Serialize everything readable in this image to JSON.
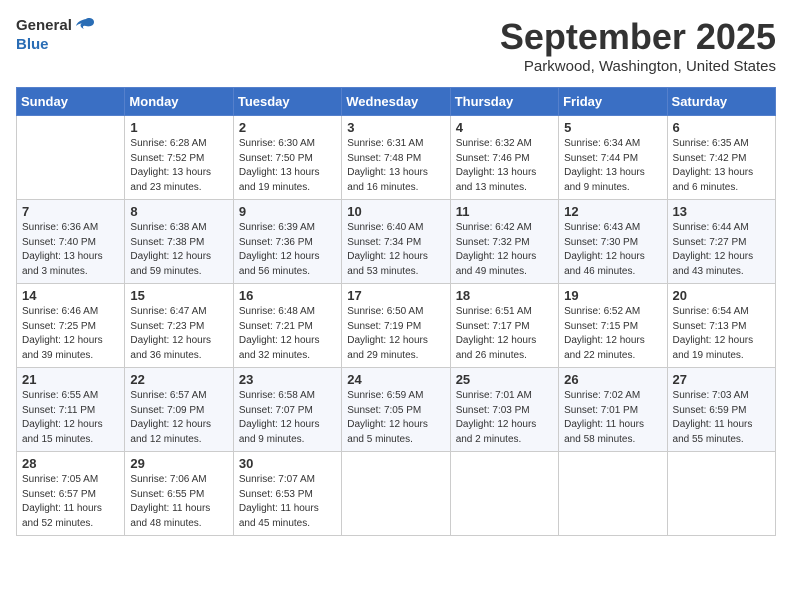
{
  "header": {
    "logo_general": "General",
    "logo_blue": "Blue",
    "month_title": "September 2025",
    "location": "Parkwood, Washington, United States"
  },
  "weekdays": [
    "Sunday",
    "Monday",
    "Tuesday",
    "Wednesday",
    "Thursday",
    "Friday",
    "Saturday"
  ],
  "weeks": [
    [
      {
        "day": "",
        "detail": ""
      },
      {
        "day": "1",
        "detail": "Sunrise: 6:28 AM\nSunset: 7:52 PM\nDaylight: 13 hours\nand 23 minutes."
      },
      {
        "day": "2",
        "detail": "Sunrise: 6:30 AM\nSunset: 7:50 PM\nDaylight: 13 hours\nand 19 minutes."
      },
      {
        "day": "3",
        "detail": "Sunrise: 6:31 AM\nSunset: 7:48 PM\nDaylight: 13 hours\nand 16 minutes."
      },
      {
        "day": "4",
        "detail": "Sunrise: 6:32 AM\nSunset: 7:46 PM\nDaylight: 13 hours\nand 13 minutes."
      },
      {
        "day": "5",
        "detail": "Sunrise: 6:34 AM\nSunset: 7:44 PM\nDaylight: 13 hours\nand 9 minutes."
      },
      {
        "day": "6",
        "detail": "Sunrise: 6:35 AM\nSunset: 7:42 PM\nDaylight: 13 hours\nand 6 minutes."
      }
    ],
    [
      {
        "day": "7",
        "detail": "Sunrise: 6:36 AM\nSunset: 7:40 PM\nDaylight: 13 hours\nand 3 minutes."
      },
      {
        "day": "8",
        "detail": "Sunrise: 6:38 AM\nSunset: 7:38 PM\nDaylight: 12 hours\nand 59 minutes."
      },
      {
        "day": "9",
        "detail": "Sunrise: 6:39 AM\nSunset: 7:36 PM\nDaylight: 12 hours\nand 56 minutes."
      },
      {
        "day": "10",
        "detail": "Sunrise: 6:40 AM\nSunset: 7:34 PM\nDaylight: 12 hours\nand 53 minutes."
      },
      {
        "day": "11",
        "detail": "Sunrise: 6:42 AM\nSunset: 7:32 PM\nDaylight: 12 hours\nand 49 minutes."
      },
      {
        "day": "12",
        "detail": "Sunrise: 6:43 AM\nSunset: 7:30 PM\nDaylight: 12 hours\nand 46 minutes."
      },
      {
        "day": "13",
        "detail": "Sunrise: 6:44 AM\nSunset: 7:27 PM\nDaylight: 12 hours\nand 43 minutes."
      }
    ],
    [
      {
        "day": "14",
        "detail": "Sunrise: 6:46 AM\nSunset: 7:25 PM\nDaylight: 12 hours\nand 39 minutes."
      },
      {
        "day": "15",
        "detail": "Sunrise: 6:47 AM\nSunset: 7:23 PM\nDaylight: 12 hours\nand 36 minutes."
      },
      {
        "day": "16",
        "detail": "Sunrise: 6:48 AM\nSunset: 7:21 PM\nDaylight: 12 hours\nand 32 minutes."
      },
      {
        "day": "17",
        "detail": "Sunrise: 6:50 AM\nSunset: 7:19 PM\nDaylight: 12 hours\nand 29 minutes."
      },
      {
        "day": "18",
        "detail": "Sunrise: 6:51 AM\nSunset: 7:17 PM\nDaylight: 12 hours\nand 26 minutes."
      },
      {
        "day": "19",
        "detail": "Sunrise: 6:52 AM\nSunset: 7:15 PM\nDaylight: 12 hours\nand 22 minutes."
      },
      {
        "day": "20",
        "detail": "Sunrise: 6:54 AM\nSunset: 7:13 PM\nDaylight: 12 hours\nand 19 minutes."
      }
    ],
    [
      {
        "day": "21",
        "detail": "Sunrise: 6:55 AM\nSunset: 7:11 PM\nDaylight: 12 hours\nand 15 minutes."
      },
      {
        "day": "22",
        "detail": "Sunrise: 6:57 AM\nSunset: 7:09 PM\nDaylight: 12 hours\nand 12 minutes."
      },
      {
        "day": "23",
        "detail": "Sunrise: 6:58 AM\nSunset: 7:07 PM\nDaylight: 12 hours\nand 9 minutes."
      },
      {
        "day": "24",
        "detail": "Sunrise: 6:59 AM\nSunset: 7:05 PM\nDaylight: 12 hours\nand 5 minutes."
      },
      {
        "day": "25",
        "detail": "Sunrise: 7:01 AM\nSunset: 7:03 PM\nDaylight: 12 hours\nand 2 minutes."
      },
      {
        "day": "26",
        "detail": "Sunrise: 7:02 AM\nSunset: 7:01 PM\nDaylight: 11 hours\nand 58 minutes."
      },
      {
        "day": "27",
        "detail": "Sunrise: 7:03 AM\nSunset: 6:59 PM\nDaylight: 11 hours\nand 55 minutes."
      }
    ],
    [
      {
        "day": "28",
        "detail": "Sunrise: 7:05 AM\nSunset: 6:57 PM\nDaylight: 11 hours\nand 52 minutes."
      },
      {
        "day": "29",
        "detail": "Sunrise: 7:06 AM\nSunset: 6:55 PM\nDaylight: 11 hours\nand 48 minutes."
      },
      {
        "day": "30",
        "detail": "Sunrise: 7:07 AM\nSunset: 6:53 PM\nDaylight: 11 hours\nand 45 minutes."
      },
      {
        "day": "",
        "detail": ""
      },
      {
        "day": "",
        "detail": ""
      },
      {
        "day": "",
        "detail": ""
      },
      {
        "day": "",
        "detail": ""
      }
    ]
  ]
}
